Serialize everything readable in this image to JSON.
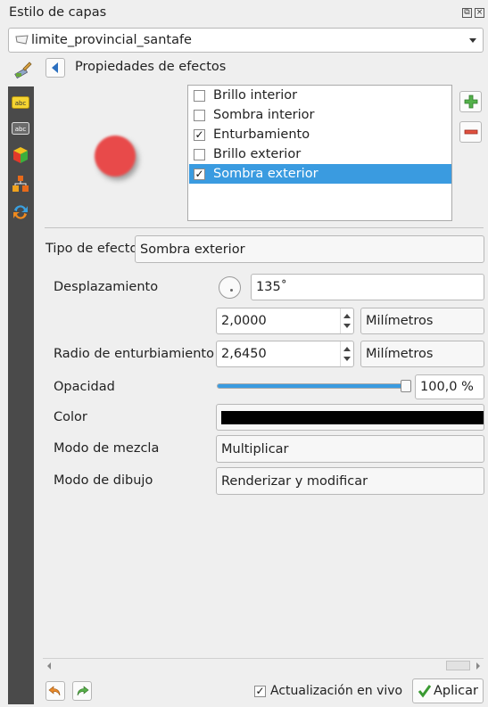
{
  "panel": {
    "title": "Estilo de capas"
  },
  "layer_combo": {
    "value": "limite_provincial_santafe"
  },
  "effects_header": {
    "title": "Propiedades de efectos"
  },
  "effects_list": [
    {
      "label": "Brillo interior",
      "checked": false,
      "selected": false
    },
    {
      "label": "Sombra interior",
      "checked": false,
      "selected": false
    },
    {
      "label": "Enturbamiento",
      "checked": true,
      "selected": false
    },
    {
      "label": "Brillo exterior",
      "checked": false,
      "selected": false
    },
    {
      "label": "Sombra exterior",
      "checked": true,
      "selected": true
    }
  ],
  "effect_type": {
    "label": "Tipo de efecto",
    "value": "Sombra exterior"
  },
  "offset": {
    "label": "Desplazamiento",
    "angle": "135˚",
    "distance": "2,0000",
    "unit": "Milímetros"
  },
  "blur_radius": {
    "label": "Radio de enturbiamiento",
    "value": "2,6450",
    "unit": "Milímetros"
  },
  "opacity": {
    "label": "Opacidad",
    "value": "100,0 %",
    "level": 1.0
  },
  "color": {
    "label": "Color",
    "value": "#000000"
  },
  "blend_mode": {
    "label": "Modo de mezcla",
    "value": "Multiplicar"
  },
  "draw_mode": {
    "label": "Modo de dibujo",
    "value": "Renderizar y modificar"
  },
  "footer": {
    "live_update_label": "Actualización en vivo",
    "live_update_checked": true,
    "apply_label": "Aplicar"
  },
  "colors": {
    "sidebar": "#4a4a4a",
    "selection": "#3a9be0",
    "preview_dot": "#e84a4a"
  }
}
